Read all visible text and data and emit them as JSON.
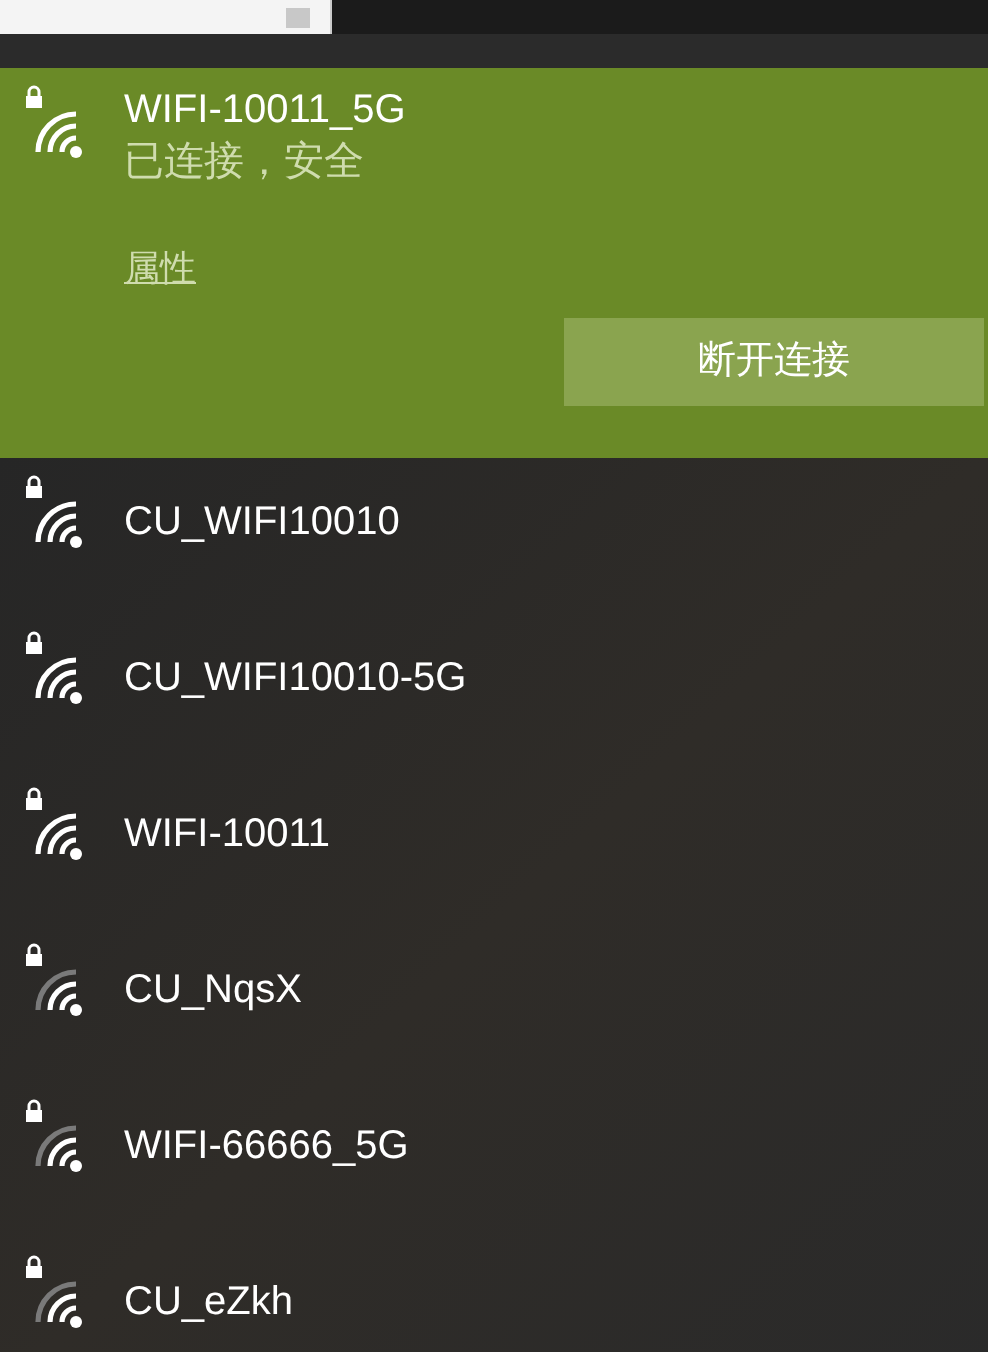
{
  "connected": {
    "name": "WIFI-10011_5G",
    "status": "已连接，安全",
    "kind": "strong",
    "properties_link": "属性",
    "disconnect_button": "断开连接"
  },
  "networks": [
    {
      "name": "CU_WIFI10010",
      "kind": "strong"
    },
    {
      "name": "CU_WIFI10010-5G",
      "kind": "strong"
    },
    {
      "name": "WIFI-10011",
      "kind": "strong"
    },
    {
      "name": "CU_NqsX",
      "kind": "good"
    },
    {
      "name": "WIFI-66666_5G",
      "kind": "good"
    },
    {
      "name": "CU_eZkh",
      "kind": "good"
    }
  ]
}
